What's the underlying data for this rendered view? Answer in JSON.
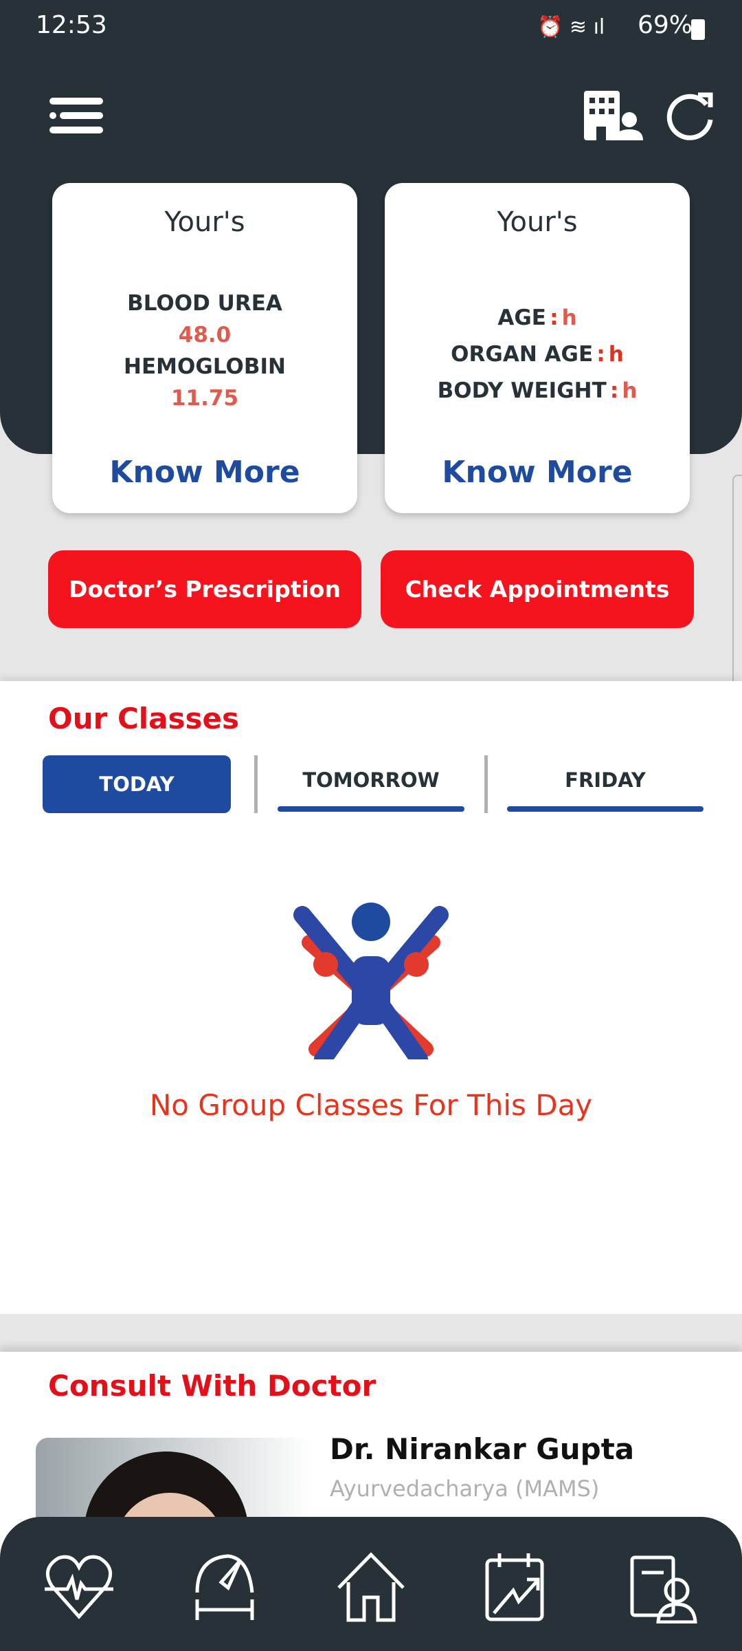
{
  "status_bar": {
    "time": "12:53",
    "battery": "69%"
  },
  "header": {
    "menu_icon": "hamburger-icon",
    "org_icon": "building-person-icon",
    "refresh_icon": "refresh-icon"
  },
  "cards": [
    {
      "title": "Your's",
      "items": [
        {
          "label": "BLOOD UREA",
          "value": "48.0"
        },
        {
          "label": "HEMOGLOBIN",
          "value": "11.75"
        }
      ],
      "link": "Know More"
    },
    {
      "title": "Your's",
      "items": [
        {
          "label": "AGE",
          "value": "h"
        },
        {
          "label": "ORGAN AGE",
          "value": "h"
        },
        {
          "label": "BODY WEIGHT",
          "value": "h"
        }
      ],
      "separator": ":",
      "link": "Know More"
    }
  ],
  "actions": {
    "prescription": "Doctor’s Prescription",
    "appointments": "Check Appointments"
  },
  "classes": {
    "title": "Our Classes",
    "tabs": [
      "TODAY",
      "TOMORROW",
      "FRIDAY"
    ],
    "active_tab": "TODAY",
    "empty_message": "No Group Classes For This Day"
  },
  "consult": {
    "title": "Consult With Doctor",
    "doctor": {
      "name": "Dr. Nirankar Gupta",
      "qualification": "Ayurvedacharya (MAMS)"
    }
  },
  "bottom_nav": [
    "heart-pulse-icon",
    "fitness-gauge-icon",
    "home-icon",
    "calendar-progress-icon",
    "doctor-report-icon"
  ],
  "colors": {
    "header": "#263238",
    "accent_red": "#f5141e",
    "accent_blue": "#1e4ba0",
    "value_red": "#e05a4e"
  }
}
